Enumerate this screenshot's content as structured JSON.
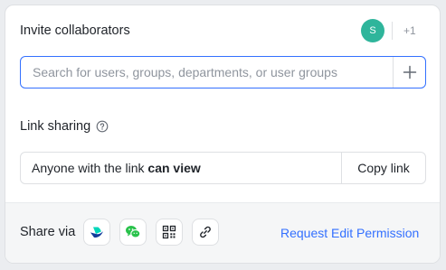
{
  "invite": {
    "title": "Invite collaborators",
    "avatar_initial": "S",
    "more_count": "+1",
    "avatar_color": "#2fb59b"
  },
  "search": {
    "placeholder": "Search for users, groups, departments, or user groups",
    "value": "",
    "add_icon": "plus-icon"
  },
  "link_sharing": {
    "title": "Link sharing",
    "help_icon": "question-circle-icon",
    "permission_prefix": "Anyone with the link",
    "permission_level": "can view",
    "copy_label": "Copy link"
  },
  "share_via": {
    "label": "Share via",
    "channels": [
      {
        "icon": "lark-app-icon"
      },
      {
        "icon": "wechat-icon"
      },
      {
        "icon": "qr-code-icon"
      },
      {
        "icon": "link-icon"
      }
    ],
    "request_label": "Request Edit Permission"
  },
  "colors": {
    "accent": "#3370ff",
    "border": "#dee0e3",
    "footer_bg": "#f5f6f7"
  }
}
